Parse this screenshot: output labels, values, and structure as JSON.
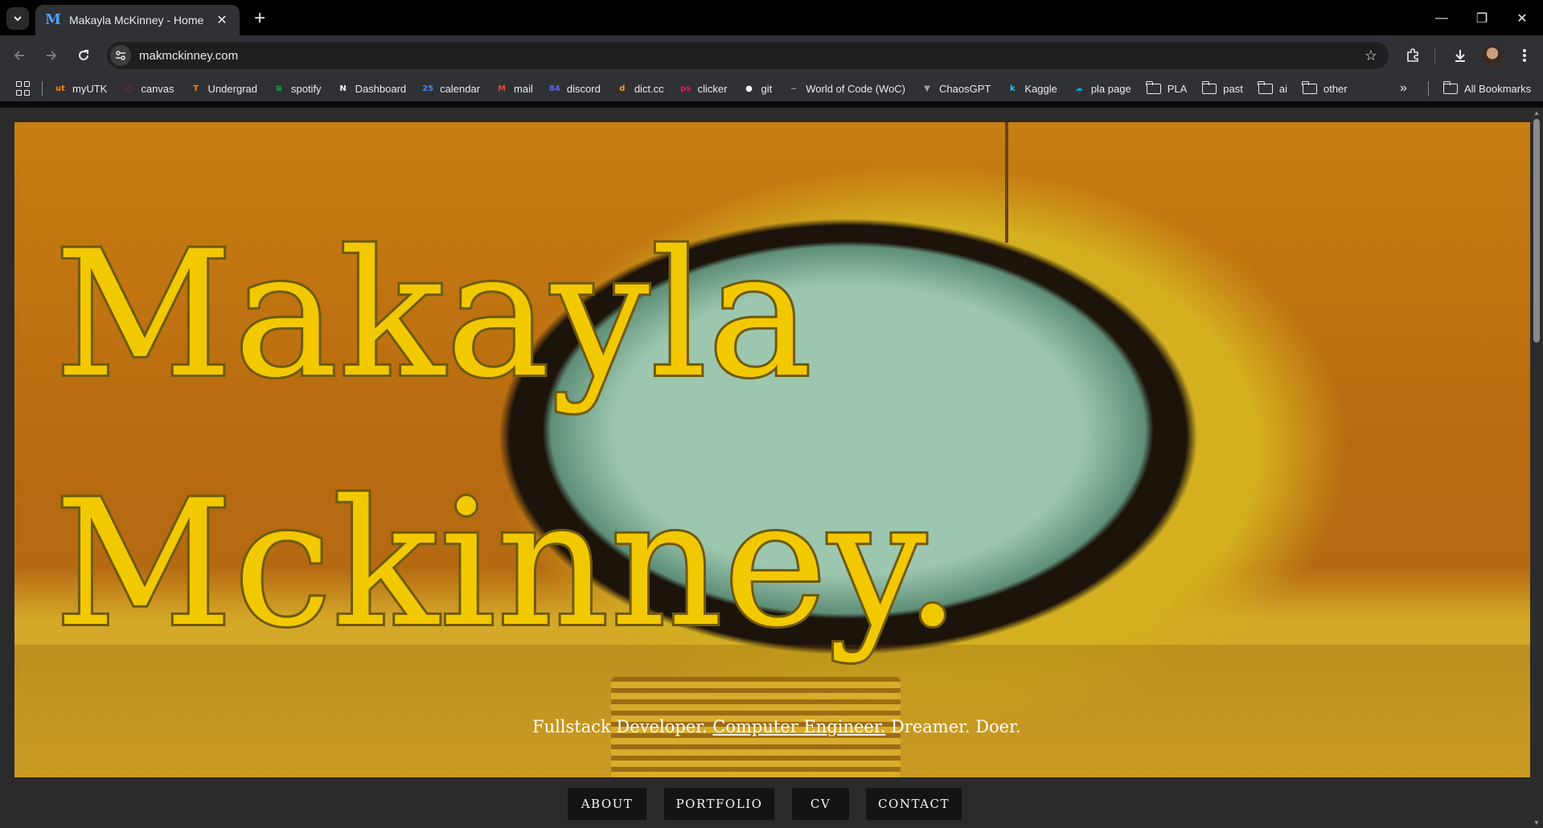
{
  "browser": {
    "tab": {
      "title": "Makayla McKinney - Home",
      "favicon_letter": "M",
      "close_glyph": "✕"
    },
    "new_tab_glyph": "+",
    "window_controls": {
      "minimize": "—",
      "restore": "❐",
      "close": "✕"
    },
    "url": "makmckinney.com",
    "bookmarks": [
      {
        "label": "myUTK",
        "icon": "utk-icon",
        "color": "#ff8200",
        "glyph": "ut"
      },
      {
        "label": "canvas",
        "icon": "canvas-icon",
        "color": "#e13f2b",
        "glyph": "◌"
      },
      {
        "label": "Undergrad",
        "icon": "tennessee-icon",
        "color": "#ff8200",
        "glyph": "T"
      },
      {
        "label": "spotify",
        "icon": "spotify-icon",
        "color": "#1db954",
        "glyph": "≋"
      },
      {
        "label": "Dashboard",
        "icon": "notion-icon",
        "color": "#ffffff",
        "glyph": "N"
      },
      {
        "label": "calendar",
        "icon": "calendar-icon",
        "color": "#4285f4",
        "glyph": "25"
      },
      {
        "label": "mail",
        "icon": "gmail-icon",
        "color": "#ea4335",
        "glyph": "M"
      },
      {
        "label": "discord",
        "icon": "discord-icon",
        "color": "#5865f2",
        "glyph": "84"
      },
      {
        "label": "dict.cc",
        "icon": "dictcc-icon",
        "color": "#f0a020",
        "glyph": "d"
      },
      {
        "label": "clicker",
        "icon": "clicker-icon",
        "color": "#e0196a",
        "glyph": "ps"
      },
      {
        "label": "git",
        "icon": "github-icon",
        "color": "#ffffff",
        "glyph": "●"
      },
      {
        "label": "World of Code (WoC)",
        "icon": "woc-icon",
        "color": "#9aa0a6",
        "glyph": "~"
      },
      {
        "label": "ChaosGPT",
        "icon": "chaosgpt-icon",
        "color": "#9aa0a6",
        "glyph": "▼"
      },
      {
        "label": "Kaggle",
        "icon": "kaggle-icon",
        "color": "#20beff",
        "glyph": "k"
      },
      {
        "label": "pla page",
        "icon": "salesforce-icon",
        "color": "#00a1e0",
        "glyph": "☁"
      }
    ],
    "bookmark_folders": [
      "PLA",
      "past",
      "ai",
      "other"
    ],
    "more_glyph": "»",
    "all_bookmarks": "All Bookmarks"
  },
  "page": {
    "name_line1": "Makayla",
    "name_line2": "Mckinney.",
    "tagline": {
      "part1": "Fullstack Developer. ",
      "link": "Computer Engineer.",
      "part2": " Dreamer. Doer."
    },
    "nav": [
      {
        "label": "ABOUT"
      },
      {
        "label": "PORTFOLIO"
      },
      {
        "label": "CV"
      },
      {
        "label": "CONTACT"
      }
    ]
  },
  "colors": {
    "name_fill": "#f2c800",
    "name_stroke": "#6e5a10",
    "nav_button_bg": "#141414",
    "nav_bar_bg": "#2a2a2a"
  }
}
